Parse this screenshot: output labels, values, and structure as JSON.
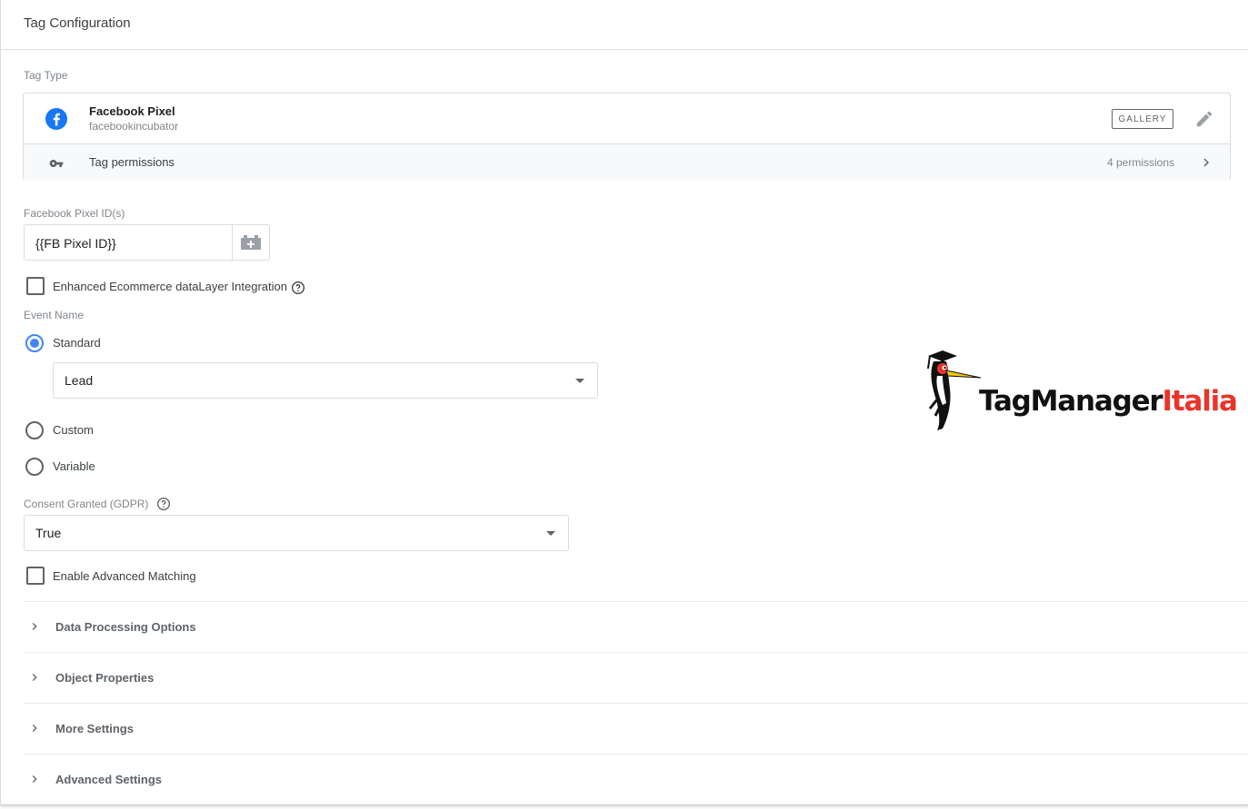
{
  "header": {
    "title": "Tag Configuration"
  },
  "tag_type": {
    "section_label": "Tag Type",
    "name": "Facebook Pixel",
    "vendor": "facebookincubator",
    "gallery_label": "GALLERY",
    "permissions_label": "Tag permissions",
    "permissions_count": "4 permissions",
    "brand_color": "#1877f2"
  },
  "pixel_id": {
    "label": "Facebook Pixel ID(s)",
    "value": "{{FB Pixel ID}}"
  },
  "enhanced_ecommerce": {
    "label": "Enhanced Ecommerce dataLayer Integration",
    "checked": false
  },
  "event_name": {
    "label": "Event Name",
    "options": [
      {
        "label": "Standard",
        "selected": true
      },
      {
        "label": "Custom",
        "selected": false
      },
      {
        "label": "Variable",
        "selected": false
      }
    ],
    "standard_value": "Lead"
  },
  "consent": {
    "label": "Consent Granted (GDPR)",
    "value": "True"
  },
  "advanced_matching": {
    "label": "Enable Advanced Matching",
    "checked": false
  },
  "sections": [
    {
      "label": "Data Processing Options"
    },
    {
      "label": "Object Properties"
    },
    {
      "label": "More Settings"
    },
    {
      "label": "Advanced Settings"
    }
  ],
  "logo": {
    "text_primary": "TagManager",
    "text_accent": "Italia",
    "accent_color": "#e8352b"
  },
  "colors": {
    "radio_selected": "#4285f4",
    "border": "#dadce0",
    "muted_text": "#80868b"
  }
}
